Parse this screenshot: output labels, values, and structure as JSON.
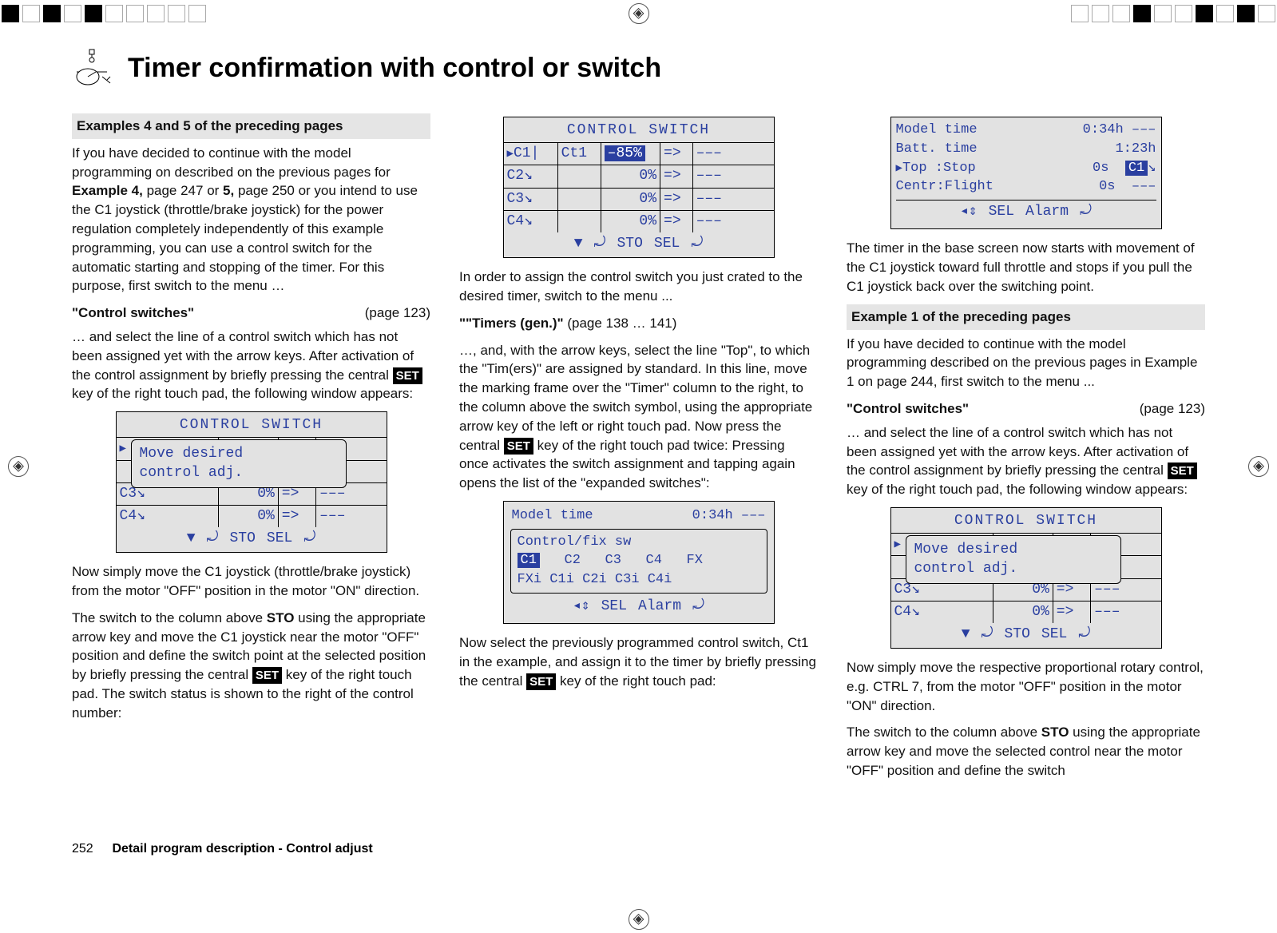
{
  "page_title": "Timer confirmation with control or switch",
  "col1": {
    "sub_head": "Examples 4 and 5 of the preceding pages",
    "p1a": "If you have decided to continue with the model programming on described on the previous pages for ",
    "p1b": "Example 4,",
    "p1c": " page 247 or ",
    "p1d": "5,",
    "p1e": " page 250 or you intend to use the C1 joystick (throttle/brake joystick) for the power regulation completely independently of this example programming, you can use a control switch for the automatic starting and stopping of the timer. For this purpose, first switch to the menu …",
    "quote": "\"Control switches\"",
    "quote_page": "(page 123)",
    "p2a": "… and select the line of a control switch which has not been assigned yet with the arrow keys. After activation of the control assignment by briefly pressing the central ",
    "p2b": " key of the right touch pad, the following window appears:",
    "lcd1": {
      "title": "CONTROL SWITCH",
      "overlay_l1": "Move desired",
      "overlay_l2": "control adj.",
      "r3a": "C3",
      "r3b": "0%",
      "r3c": "=>",
      "r3d": "–––",
      "r4a": "C4",
      "r4b": "0%",
      "r4c": "=>",
      "r4d": "–––",
      "foot_down": "▼",
      "foot_sto": "STO",
      "foot_sel": "SEL"
    },
    "p3": "Now simply move the C1 joystick (throttle/brake joystick) from the motor \"OFF\" position in the motor \"ON\" direction.",
    "p4a": "The switch to the column above ",
    "p4b": "STO",
    "p4c": " using the appropriate arrow key and move the C1 joystick near the motor \"OFF\" position and define the switch point at the selected position by briefly pressing the central ",
    "p4d": " key of the right touch pad. The switch status is shown to the right of the control number:"
  },
  "col2": {
    "lcd2": {
      "title": "CONTROL SWITCH",
      "r1a": "C1",
      "r1b": "Ct1",
      "r1c": "–85%",
      "r1d": "=>",
      "r1e": "–––",
      "r2a": "C2",
      "r2b": "0%",
      "r2c": "=>",
      "r2d": "–––",
      "r3a": "C3",
      "r3b": "0%",
      "r3c": "=>",
      "r3d": "–––",
      "r4a": "C4",
      "r4b": "0%",
      "r4c": "=>",
      "r4d": "–––",
      "foot_down": "▼",
      "foot_sto": "STO",
      "foot_sel": "SEL"
    },
    "p1": "In order to assign the control switch you just crated to the desired timer, switch to the menu ...",
    "quote": "\"\"Timers (gen.)\"",
    "quote_page": " (page 138 … 141)",
    "p2a": "…, and, with the arrow keys, select the line \"Top\", to which the \"Tim(ers)\" are assigned by standard. In this line, move the marking frame over the \"Timer\" column to the right, to the column above the switch symbol, using the appropriate arrow key of the left or right touch pad. Now press the central ",
    "p2b": " key of the right touch pad twice: Pressing once activates the switch assignment and tapping again opens the list of the \"expanded switches\":",
    "lcd3": {
      "r1a": "Model time",
      "r1b": "0:34h",
      "r1c": "–––",
      "box_title": "Control/fix sw",
      "box_r2": "C1   C2   C3   C4   FX",
      "box_r3": "FXi  C1i  C2i  C3i  C4i",
      "foot_sel": "SEL",
      "foot_alarm": "Alarm"
    },
    "p3a": "Now select the previously programmed control switch, Ct1 in the example, and assign it to the timer by briefly pressing the central ",
    "p3b": " key of the right touch pad:"
  },
  "col3": {
    "lcd4": {
      "r1a": "Model time",
      "r1b": "0:34h",
      "r1c": "–––",
      "r2a": "Batt. time",
      "r2b": "1:23h",
      "r3a": "Top  :Stop",
      "r3b": "0s",
      "r3c": "C1",
      "r4a": "Centr:Flight",
      "r4b": "0s",
      "r4c": "–––",
      "foot_sel": "SEL",
      "foot_alarm": "Alarm"
    },
    "p1": "The timer in the base screen now starts with movement of the C1 joystick toward full throttle and stops if you pull the C1 joystick back over the switching point.",
    "sub_head": "Example 1 of the preceding pages",
    "p2": "If you have decided to continue with the model programming described on the previous pages in Example 1 on page 244, first switch to the menu ...",
    "quote": "\"Control switches\"",
    "quote_page": "(page 123)",
    "p3a": "… and select the line of a control switch which has not been assigned yet with the arrow keys. After activation of the control assignment by briefly pressing the central ",
    "p3b": " key of the right touch pad, the following window appears:",
    "lcd5": {
      "title": "CONTROL SWITCH",
      "overlay_l1": "Move desired",
      "overlay_l2": "control adj.",
      "r3a": "C3",
      "r3b": "0%",
      "r3c": "=>",
      "r3d": "–––",
      "r4a": "C4",
      "r4b": "0%",
      "r4c": "=>",
      "r4d": "–––",
      "foot_down": "▼",
      "foot_sto": "STO",
      "foot_sel": "SEL"
    },
    "p4": "Now simply move the respective proportional rotary control, e.g. CTRL 7, from the motor \"OFF\" position in the motor \"ON\" direction.",
    "p5a": "The switch to the column above ",
    "p5b": "STO",
    "p5c": " using the appropriate arrow key and move the selected control near the motor \"OFF\" position and define the switch"
  },
  "set_label": "SET",
  "footer": {
    "page_num": "252",
    "section": "Detail program description - Control adjust"
  }
}
